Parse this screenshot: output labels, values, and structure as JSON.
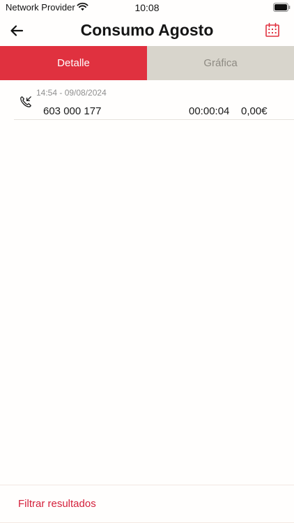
{
  "status_bar": {
    "carrier": "Network Provider",
    "time": "10:08"
  },
  "header": {
    "title": "Consumo Agosto"
  },
  "tabs": [
    {
      "label": "Detalle",
      "active": true
    },
    {
      "label": "Gráfica",
      "active": false
    }
  ],
  "calls": [
    {
      "datetime": "14:54 - 09/08/2024",
      "number": "603 000 177",
      "duration": "00:00:04",
      "cost": "0,00€",
      "direction_icon": "incoming-call-icon"
    }
  ],
  "footer": {
    "filter_label": "Filtrar resultados"
  },
  "colors": {
    "accent": "#e0313f",
    "tab_inactive_bg": "#d8d5cc",
    "link": "#d4203b"
  }
}
